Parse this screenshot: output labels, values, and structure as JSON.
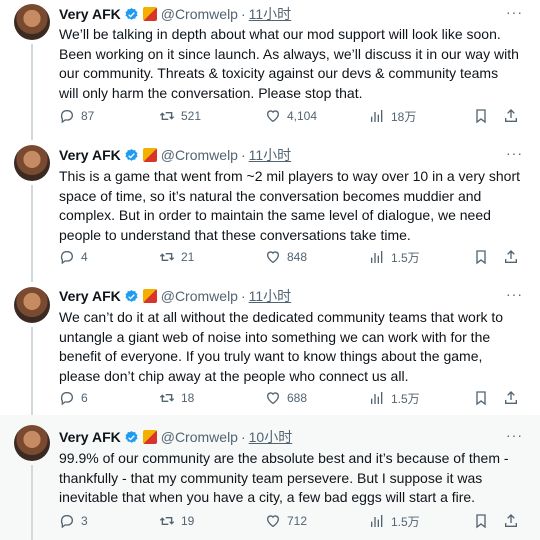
{
  "tweets": [
    {
      "name": "Very AFK",
      "handle": "@Cromwelp",
      "dot": "·",
      "time": "11小时",
      "text": "We’ll be talking in depth about what our mod support will look like soon. Been working on it since launch. As always, we’ll discuss it in our way with our community. Threats & toxicity against our devs & community teams will only harm the conversation. Please stop that.",
      "replies": "87",
      "retweets": "521",
      "likes": "4,104",
      "views": "18万"
    },
    {
      "name": "Very AFK",
      "handle": "@Cromwelp",
      "dot": "·",
      "time": "11小时",
      "text": "This is a game that went from ~2 mil players to way over 10 in a very short space of time, so it’s natural the conversation becomes muddier and complex. But in order to maintain the same level of dialogue, we need people to understand that these conversations take time.",
      "replies": "4",
      "retweets": "21",
      "likes": "848",
      "views": "1.5万"
    },
    {
      "name": "Very AFK",
      "handle": "@Cromwelp",
      "dot": "·",
      "time": "11小时",
      "text": "We can’t do it at all without the dedicated community teams that work to untangle a giant web of noise into something we can work with for the benefit of everyone. If you truly want to know things about the game, please don’t chip away at the people who connect us all.",
      "replies": "6",
      "retweets": "18",
      "likes": "688",
      "views": "1.5万"
    },
    {
      "name": "Very AFK",
      "handle": "@Cromwelp",
      "dot": "·",
      "time": "10小时",
      "text": "99.9% of our community are the absolute best and it’s because of them - thankfully - that my community team persevere. But I suppose it was inevitable that when you have a city, a few bad eggs will start a fire.",
      "replies": "3",
      "retweets": "19",
      "likes": "712",
      "views": "1.5万"
    }
  ],
  "colors": {
    "text": "#0f1419",
    "secondary": "#536471",
    "verified": "#1d9bf0",
    "thread_line": "#cfd9de",
    "highlight_bg": "#f7f9f9"
  },
  "icons": [
    "verified-icon",
    "game-badge-icon",
    "more-icon",
    "reply-icon",
    "retweet-icon",
    "like-icon",
    "views-icon",
    "bookmark-icon",
    "share-icon"
  ]
}
